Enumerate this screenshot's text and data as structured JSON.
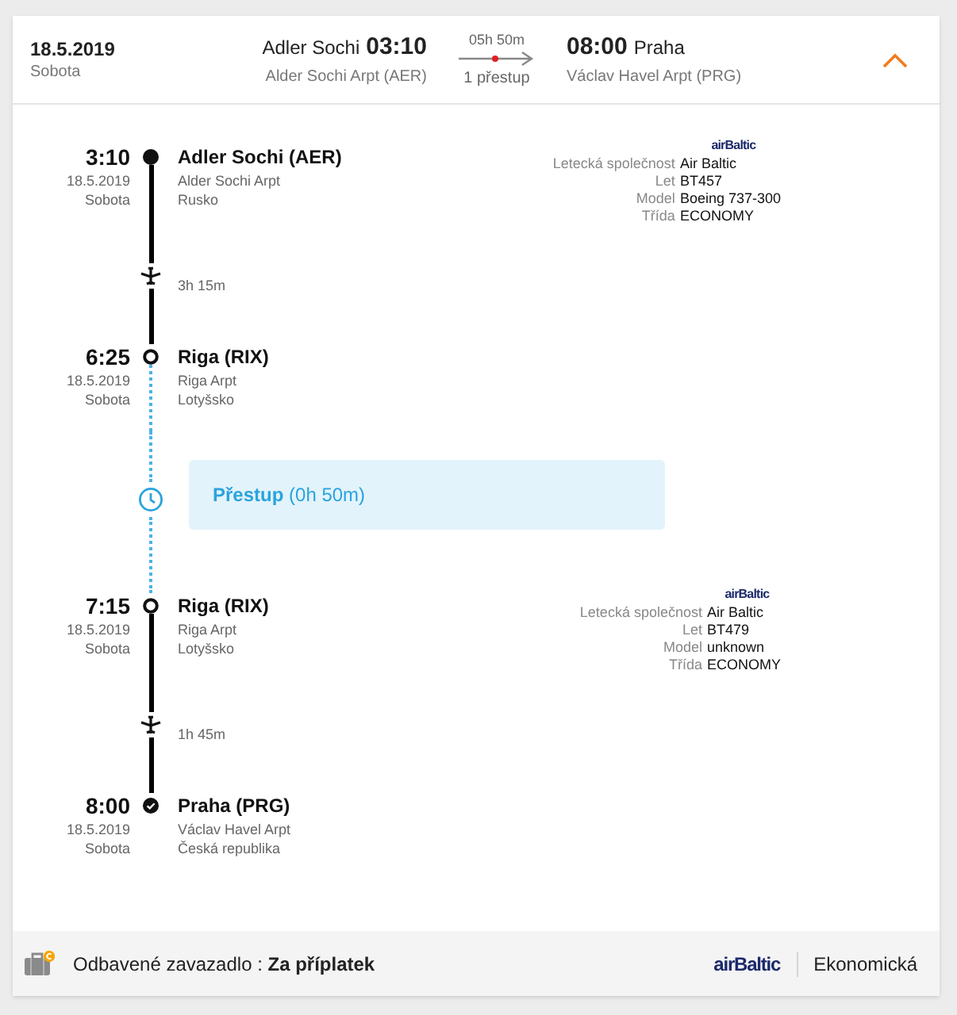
{
  "header": {
    "date": "18.5.2019",
    "weekday": "Sobota",
    "departure": {
      "city": "Adler Sochi",
      "time": "03:10",
      "airport": "Alder Sochi Arpt (AER)"
    },
    "duration": "05h 50m",
    "transfers": "1 přestup",
    "arrival": {
      "time": "08:00",
      "city": "Praha",
      "airport": "Václav Havel Arpt (PRG)"
    },
    "expanded": true
  },
  "timeline": [
    {
      "kind": "origin",
      "time": "3:10",
      "date": "18.5.2019",
      "weekday": "Sobota",
      "place": "Adler Sochi (AER)",
      "airport": "Alder Sochi Arpt",
      "country": "Rusko",
      "flight": {
        "logo": "airBaltic",
        "details": [
          {
            "label": "Letecká společnost",
            "value": "Air Baltic"
          },
          {
            "label": "Let",
            "value": "BT457"
          },
          {
            "label": "Model",
            "value": "Boeing 737-300"
          },
          {
            "label": "Třída",
            "value": "ECONOMY"
          }
        ]
      }
    },
    {
      "kind": "flight",
      "duration": "3h 15m"
    },
    {
      "kind": "stop",
      "time": "6:25",
      "date": "18.5.2019",
      "weekday": "Sobota",
      "place": "Riga (RIX)",
      "airport": "Riga Arpt",
      "country": "Lotyšsko"
    },
    {
      "kind": "layover",
      "text": "**Přestup** (0h 50m)"
    },
    {
      "kind": "stop",
      "time": "7:15",
      "date": "18.5.2019",
      "weekday": "Sobota",
      "place": "Riga (RIX)",
      "airport": "Riga Arpt",
      "country": "Lotyšsko",
      "flight": {
        "logo": "airBaltic",
        "details": [
          {
            "label": "Letecká společnost",
            "value": "Air Baltic"
          },
          {
            "label": "Let",
            "value": "BT479"
          },
          {
            "label": "Model",
            "value": "unknown"
          },
          {
            "label": "Třída",
            "value": "ECONOMY"
          }
        ]
      }
    },
    {
      "kind": "flight",
      "duration": "1h 45m"
    },
    {
      "kind": "destination",
      "time": "8:00",
      "date": "18.5.2019",
      "weekday": "Sobota",
      "place": "Praha (PRG)",
      "airport": "Václav Havel Arpt",
      "country": "Česká republika"
    }
  ],
  "footer": {
    "baggage": "Odbavené zavazadlo : **Za příplatek**",
    "airline": "airBaltic",
    "cabin": "Ekonomická"
  }
}
